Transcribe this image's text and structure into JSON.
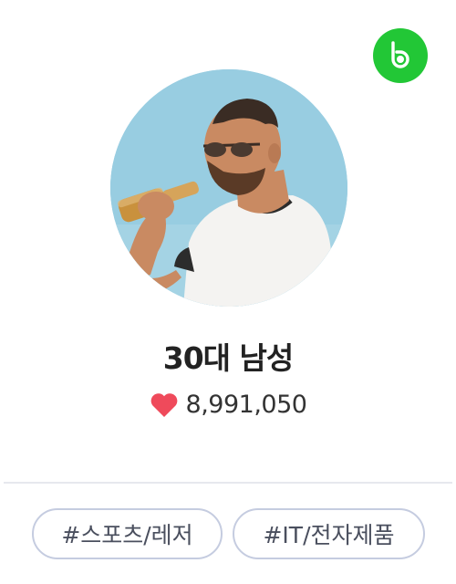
{
  "brand": {
    "icon": "b-logo-icon",
    "color": "#22c736"
  },
  "profile": {
    "title": "30대 남성",
    "likes": "8,991,050",
    "heart_color": "#ef4a5b"
  },
  "tags": [
    {
      "label": "#스포츠/레저"
    },
    {
      "label": "#IT/전자제품"
    }
  ]
}
